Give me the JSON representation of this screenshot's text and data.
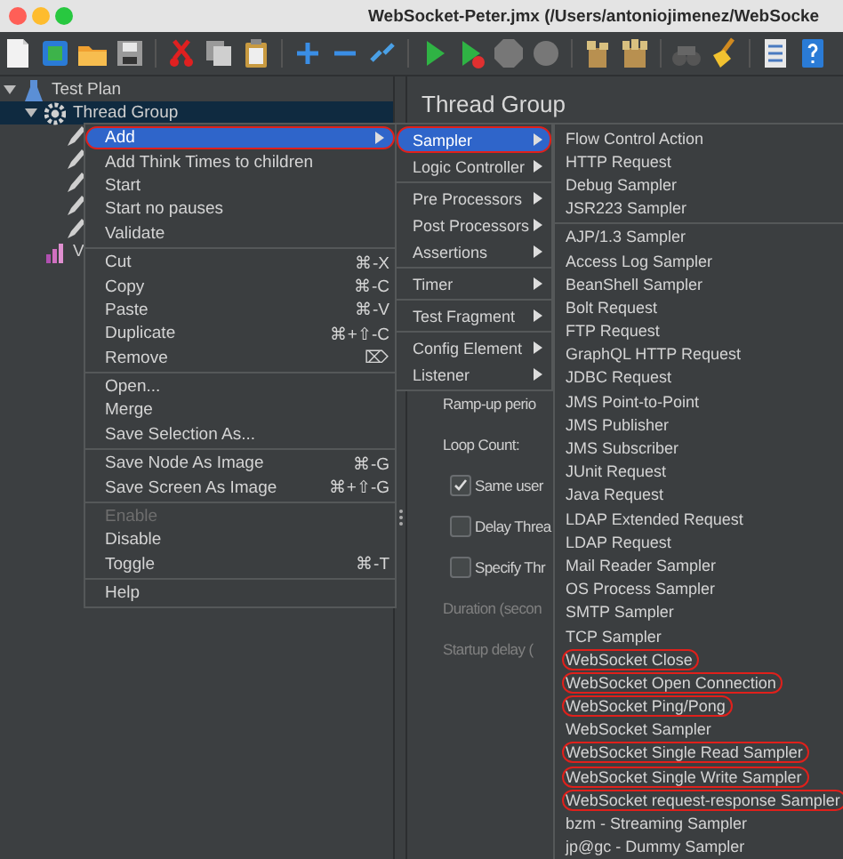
{
  "window": {
    "title": "WebSocket-Peter.jmx (/Users/antoniojimenez/WebSocke"
  },
  "tree": [
    {
      "label": "Test Plan",
      "kind": "test_plan",
      "selected": false,
      "expanded": true,
      "children": [
        {
          "label": "Thread Group",
          "kind": "thread_group",
          "selected": true,
          "expanded": true,
          "children": [
            {
              "kind": "sampler",
              "selected": false
            },
            {
              "kind": "sampler",
              "selected": false
            },
            {
              "kind": "sampler",
              "selected": false
            },
            {
              "kind": "sampler",
              "selected": false
            },
            {
              "kind": "sampler",
              "selected": false
            }
          ]
        },
        {
          "label": "V",
          "kind": "listener",
          "selected": false
        }
      ]
    }
  ],
  "panel": {
    "title": "Thread Group",
    "fields": [
      {
        "kind": "label",
        "text": "Ramp-up perio",
        "disabled": false
      },
      {
        "kind": "label",
        "text": "Loop Count:",
        "disabled": false
      },
      {
        "kind": "checkbox",
        "text": "Same user",
        "checked": true,
        "disabled": false
      },
      {
        "kind": "checkbox",
        "text": "Delay Threa",
        "checked": false,
        "disabled": false
      },
      {
        "kind": "checkbox",
        "text": "Specify Thr",
        "checked": false,
        "disabled": false
      },
      {
        "kind": "label",
        "text": "Duration (secon",
        "disabled": true
      },
      {
        "kind": "label",
        "text": "Startup delay (",
        "disabled": true
      }
    ]
  },
  "context_menu": [
    {
      "kind": "item",
      "label": "Add",
      "selected": true,
      "disabled": false,
      "arrow": true,
      "circled": true
    },
    {
      "kind": "item",
      "label": "Add Think Times to children",
      "selected": false,
      "disabled": false,
      "arrow": false,
      "circled": false
    },
    {
      "kind": "item",
      "label": "Start",
      "selected": false,
      "disabled": false,
      "arrow": false,
      "circled": false
    },
    {
      "kind": "item",
      "label": "Start no pauses",
      "selected": false,
      "disabled": false,
      "arrow": false,
      "circled": false
    },
    {
      "kind": "item",
      "label": "Validate",
      "selected": false,
      "disabled": false,
      "arrow": false,
      "circled": false
    },
    {
      "kind": "separator"
    },
    {
      "kind": "item",
      "label": "Cut",
      "shortcut": "⌘-X",
      "selected": false,
      "disabled": false,
      "arrow": false,
      "circled": false
    },
    {
      "kind": "item",
      "label": "Copy",
      "shortcut": "⌘-C",
      "selected": false,
      "disabled": false,
      "arrow": false,
      "circled": false
    },
    {
      "kind": "item",
      "label": "Paste",
      "shortcut": "⌘-V",
      "selected": false,
      "disabled": false,
      "arrow": false,
      "circled": false
    },
    {
      "kind": "item",
      "label": "Duplicate",
      "shortcut": "⌘+⇧-C",
      "selected": false,
      "disabled": false,
      "arrow": false,
      "circled": false
    },
    {
      "kind": "item",
      "label": "Remove",
      "shortcut": "⌦",
      "selected": false,
      "disabled": false,
      "arrow": false,
      "circled": false
    },
    {
      "kind": "separator"
    },
    {
      "kind": "item",
      "label": "Open...",
      "selected": false,
      "disabled": false,
      "arrow": false,
      "circled": false
    },
    {
      "kind": "item",
      "label": "Merge",
      "selected": false,
      "disabled": false,
      "arrow": false,
      "circled": false
    },
    {
      "kind": "item",
      "label": "Save Selection As...",
      "selected": false,
      "disabled": false,
      "arrow": false,
      "circled": false
    },
    {
      "kind": "separator"
    },
    {
      "kind": "item",
      "label": "Save Node As Image",
      "shortcut": "⌘-G",
      "selected": false,
      "disabled": false,
      "arrow": false,
      "circled": false
    },
    {
      "kind": "item",
      "label": "Save Screen As Image",
      "shortcut": "⌘+⇧-G",
      "selected": false,
      "disabled": false,
      "arrow": false,
      "circled": false
    },
    {
      "kind": "separator"
    },
    {
      "kind": "item",
      "label": "Enable",
      "selected": false,
      "disabled": true,
      "arrow": false,
      "circled": false
    },
    {
      "kind": "item",
      "label": "Disable",
      "selected": false,
      "disabled": false,
      "arrow": false,
      "circled": false
    },
    {
      "kind": "item",
      "label": "Toggle",
      "shortcut": "⌘-T",
      "selected": false,
      "disabled": false,
      "arrow": false,
      "circled": false
    },
    {
      "kind": "separator"
    },
    {
      "kind": "item",
      "label": "Help",
      "selected": false,
      "disabled": false,
      "arrow": false,
      "circled": false
    }
  ],
  "add_menu": [
    {
      "kind": "item",
      "label": "Sampler",
      "selected": true,
      "arrow": true,
      "circled": true
    },
    {
      "kind": "item",
      "label": "Logic Controller",
      "selected": false,
      "arrow": true,
      "circled": false
    },
    {
      "kind": "separator"
    },
    {
      "kind": "item",
      "label": "Pre Processors",
      "selected": false,
      "arrow": true,
      "circled": false
    },
    {
      "kind": "item",
      "label": "Post Processors",
      "selected": false,
      "arrow": true,
      "circled": false
    },
    {
      "kind": "item",
      "label": "Assertions",
      "selected": false,
      "arrow": true,
      "circled": false
    },
    {
      "kind": "separator"
    },
    {
      "kind": "item",
      "label": "Timer",
      "selected": false,
      "arrow": true,
      "circled": false
    },
    {
      "kind": "separator"
    },
    {
      "kind": "item",
      "label": "Test Fragment",
      "selected": false,
      "arrow": true,
      "circled": false
    },
    {
      "kind": "separator"
    },
    {
      "kind": "item",
      "label": "Config Element",
      "selected": false,
      "arrow": true,
      "circled": false
    },
    {
      "kind": "item",
      "label": "Listener",
      "selected": false,
      "arrow": true,
      "circled": false
    }
  ],
  "sampler_menu": [
    {
      "kind": "item",
      "label": "Flow Control Action",
      "selected": false,
      "circled": false
    },
    {
      "kind": "item",
      "label": "HTTP Request",
      "selected": false,
      "circled": false
    },
    {
      "kind": "item",
      "label": "Debug Sampler",
      "selected": false,
      "circled": false
    },
    {
      "kind": "item",
      "label": "JSR223 Sampler",
      "selected": false,
      "circled": false
    },
    {
      "kind": "separator"
    },
    {
      "kind": "item",
      "label": "AJP/1.3 Sampler",
      "selected": false,
      "circled": false
    },
    {
      "kind": "item",
      "label": "Access Log Sampler",
      "selected": false,
      "circled": false
    },
    {
      "kind": "item",
      "label": "BeanShell Sampler",
      "selected": false,
      "circled": false
    },
    {
      "kind": "item",
      "label": "Bolt Request",
      "selected": false,
      "circled": false
    },
    {
      "kind": "item",
      "label": "FTP Request",
      "selected": false,
      "circled": false
    },
    {
      "kind": "item",
      "label": "GraphQL HTTP Request",
      "selected": false,
      "circled": false
    },
    {
      "kind": "item",
      "label": "JDBC Request",
      "selected": false,
      "circled": false
    },
    {
      "kind": "item",
      "label": "JMS Point-to-Point",
      "selected": false,
      "circled": false
    },
    {
      "kind": "item",
      "label": "JMS Publisher",
      "selected": false,
      "circled": false
    },
    {
      "kind": "item",
      "label": "JMS Subscriber",
      "selected": false,
      "circled": false
    },
    {
      "kind": "item",
      "label": "JUnit Request",
      "selected": false,
      "circled": false
    },
    {
      "kind": "item",
      "label": "Java Request",
      "selected": false,
      "circled": false
    },
    {
      "kind": "item",
      "label": "LDAP Extended Request",
      "selected": false,
      "circled": false
    },
    {
      "kind": "item",
      "label": "LDAP Request",
      "selected": false,
      "circled": false
    },
    {
      "kind": "item",
      "label": "Mail Reader Sampler",
      "selected": false,
      "circled": false
    },
    {
      "kind": "item",
      "label": "OS Process Sampler",
      "selected": false,
      "circled": false
    },
    {
      "kind": "item",
      "label": "SMTP Sampler",
      "selected": false,
      "circled": false
    },
    {
      "kind": "item",
      "label": "TCP Sampler",
      "selected": false,
      "circled": false
    },
    {
      "kind": "item",
      "label": "WebSocket Close",
      "selected": false,
      "circled": true
    },
    {
      "kind": "item",
      "label": "WebSocket Open Connection",
      "selected": false,
      "circled": true
    },
    {
      "kind": "item",
      "label": "WebSocket Ping/Pong",
      "selected": false,
      "circled": true
    },
    {
      "kind": "item",
      "label": "WebSocket Sampler",
      "selected": false,
      "circled": false
    },
    {
      "kind": "item",
      "label": "WebSocket Single Read Sampler",
      "selected": false,
      "circled": true
    },
    {
      "kind": "item",
      "label": "WebSocket Single Write Sampler",
      "selected": false,
      "circled": true
    },
    {
      "kind": "item",
      "label": "WebSocket request-response Sampler",
      "selected": false,
      "circled": true
    },
    {
      "kind": "item",
      "label": "bzm - Streaming Sampler",
      "selected": false,
      "circled": false
    },
    {
      "kind": "item",
      "label": "jp@gc - Dummy Sampler",
      "selected": false,
      "circled": false
    }
  ]
}
